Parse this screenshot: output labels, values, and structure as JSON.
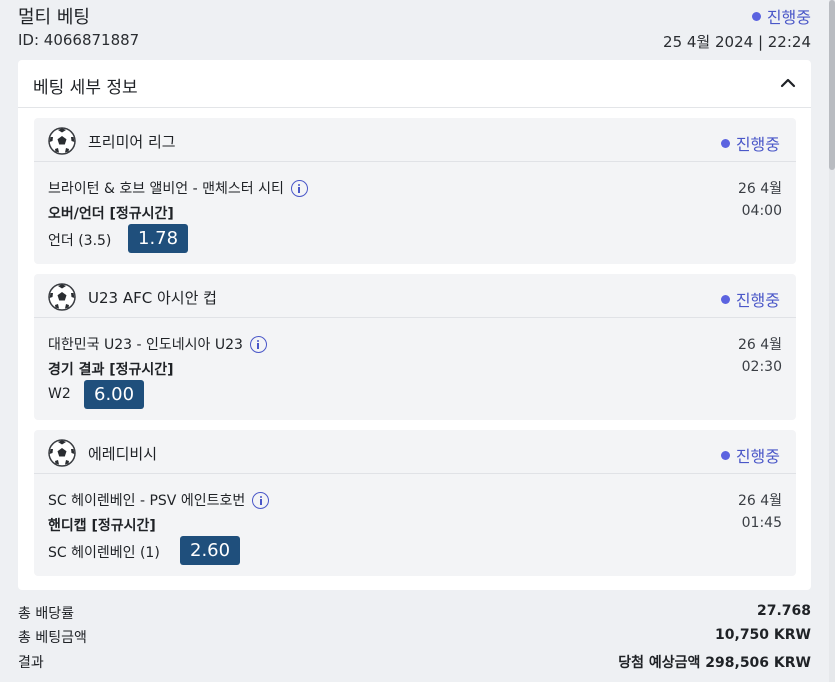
{
  "header": {
    "title": "멀티 베팅",
    "bet_id": "ID: 4066871887",
    "status": "진행중",
    "datetime": "25 4월 2024 | 22:24"
  },
  "details": {
    "title": "베팅 세부 정보",
    "collapse_icon": "chevron-up-icon"
  },
  "selections": [
    {
      "league": "프리미어 리그",
      "status": "진행중",
      "match": "브라이턴 & 호브 앨비언 - 맨체스터 시티",
      "market": "오버/언더 [정규시간]",
      "pick": "언더 (3.5)",
      "odds": "1.78",
      "date": "26 4월",
      "time": "04:00"
    },
    {
      "league": "U23 AFC 아시안 컵",
      "status": "진행중",
      "match": "대한민국 U23 - 인도네시아 U23",
      "market": "경기 결과 [정규시간]",
      "pick": "W2",
      "odds": "6.00",
      "date": "26 4월",
      "time": "02:30"
    },
    {
      "league": "에레디비시",
      "status": "진행중",
      "match": "SC 헤이렌베인 - PSV 에인트호번",
      "market": "핸디캡 [정규시간]",
      "pick": "SC 헤이렌베인 (1)",
      "odds": "2.60",
      "date": "26 4월",
      "time": "01:45"
    }
  ],
  "summary": {
    "total_odds_label": "총 배당률",
    "total_odds": "27.768",
    "stake_label": "총 베팅금액",
    "stake": "10,750 KRW",
    "result_label": "결과",
    "result": "당첨 예상금액 298,506 KRW"
  },
  "colors": {
    "status": "#5b63e0",
    "odds_bg": "#1f4f7c"
  }
}
